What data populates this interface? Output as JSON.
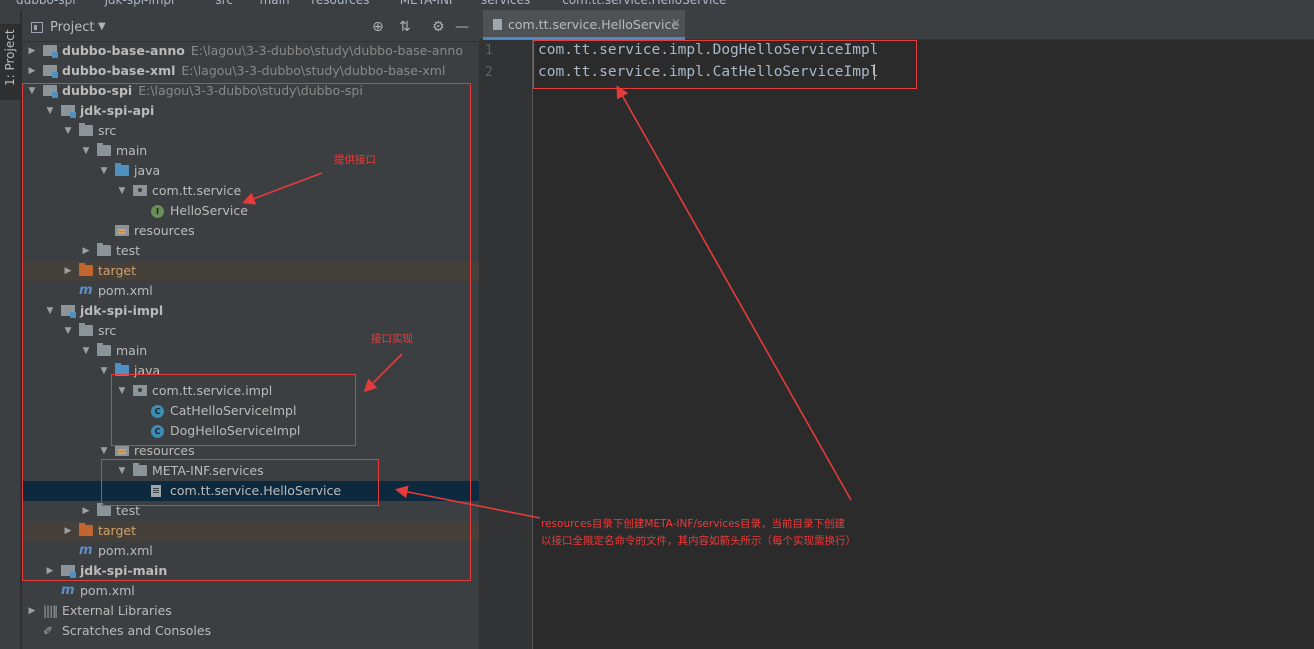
{
  "breadcrumbs": [
    "dubbo-spi",
    "jdk-spi-impl",
    "src",
    "main",
    "resources",
    "META-INF",
    "services",
    "com.tt.service.HelloService"
  ],
  "side_stripe": {
    "label": "1: Project"
  },
  "project_panel": {
    "title": "Project",
    "tools": [
      "locate-icon",
      "collapse-icon",
      "gear-icon",
      "hide-icon"
    ]
  },
  "tree": [
    {
      "label": "dubbo-base-anno",
      "path": "E:\\lagou\\3-3-dubbo\\study\\dubbo-base-anno",
      "icon": "module-icon",
      "arrow": "▶",
      "depth": 0,
      "bold": true
    },
    {
      "label": "dubbo-base-xml",
      "path": "E:\\lagou\\3-3-dubbo\\study\\dubbo-base-xml",
      "icon": "module-icon",
      "arrow": "▶",
      "depth": 0,
      "bold": true
    },
    {
      "label": "dubbo-spi",
      "path": "E:\\lagou\\3-3-dubbo\\study\\dubbo-spi",
      "icon": "module-icon",
      "arrow": "▼",
      "depth": 0,
      "bold": true
    },
    {
      "label": "jdk-spi-api",
      "icon": "module-icon",
      "arrow": "▼",
      "depth": 1,
      "bold": true
    },
    {
      "label": "src",
      "icon": "folder-icon",
      "arrow": "▼",
      "depth": 2
    },
    {
      "label": "main",
      "icon": "folder-icon",
      "arrow": "▼",
      "depth": 3
    },
    {
      "label": "java",
      "icon": "source-folder-icon",
      "arrow": "▼",
      "depth": 4
    },
    {
      "label": "com.tt.service",
      "icon": "package-icon",
      "arrow": "▼",
      "depth": 5
    },
    {
      "label": "HelloService",
      "icon": "interface-icon",
      "arrow": "",
      "depth": 6
    },
    {
      "label": "resources",
      "icon": "resources-folder-icon",
      "arrow": "",
      "depth": 4
    },
    {
      "label": "test",
      "icon": "folder-icon",
      "arrow": "▶",
      "depth": 3
    },
    {
      "label": "target",
      "icon": "excluded-folder-icon",
      "arrow": "▶",
      "depth": 2,
      "highlight": true
    },
    {
      "label": "pom.xml",
      "icon": "maven-icon",
      "arrow": "",
      "depth": 2
    },
    {
      "label": "jdk-spi-impl",
      "icon": "module-icon",
      "arrow": "▼",
      "depth": 1,
      "bold": true
    },
    {
      "label": "src",
      "icon": "folder-icon",
      "arrow": "▼",
      "depth": 2
    },
    {
      "label": "main",
      "icon": "folder-icon",
      "arrow": "▼",
      "depth": 3
    },
    {
      "label": "java",
      "icon": "source-folder-icon",
      "arrow": "▼",
      "depth": 4
    },
    {
      "label": "com.tt.service.impl",
      "icon": "package-icon",
      "arrow": "▼",
      "depth": 5
    },
    {
      "label": "CatHelloServiceImpl",
      "icon": "class-icon",
      "arrow": "",
      "depth": 6
    },
    {
      "label": "DogHelloServiceImpl",
      "icon": "class-icon",
      "arrow": "",
      "depth": 6
    },
    {
      "label": "resources",
      "icon": "resources-folder-icon",
      "arrow": "▼",
      "depth": 4
    },
    {
      "label": "META-INF.services",
      "icon": "folder-icon",
      "arrow": "▼",
      "depth": 5
    },
    {
      "label": "com.tt.service.HelloService",
      "icon": "text-file-icon",
      "arrow": "",
      "depth": 6,
      "selected": true
    },
    {
      "label": "test",
      "icon": "folder-icon",
      "arrow": "▶",
      "depth": 3
    },
    {
      "label": "target",
      "icon": "excluded-folder-icon",
      "arrow": "▶",
      "depth": 2,
      "highlight": true
    },
    {
      "label": "pom.xml",
      "icon": "maven-icon",
      "arrow": "",
      "depth": 2
    },
    {
      "label": "jdk-spi-main",
      "icon": "module-icon",
      "arrow": "▶",
      "depth": 1,
      "bold": true
    },
    {
      "label": "pom.xml",
      "icon": "maven-icon",
      "arrow": "",
      "depth": 1
    },
    {
      "label": "External Libraries",
      "icon": "libraries-icon",
      "arrow": "▶",
      "depth": 0
    },
    {
      "label": "Scratches and Consoles",
      "icon": "scratches-icon",
      "arrow": "",
      "depth": 0
    }
  ],
  "editor": {
    "tab_label": "com.tt.service.HelloService",
    "lines": [
      {
        "number": "1",
        "text": "com.tt.service.impl.DogHelloServiceImpl"
      },
      {
        "number": "2",
        "text": "com.tt.service.impl.CatHelloServiceImpl"
      }
    ]
  },
  "annotations": {
    "interface_note": "提供接口",
    "impl_note": "接口实现",
    "resources_note_line1": "resources目录下创建META-INF/services目录，当前目录下创建",
    "resources_note_line2": "以接口全限定名命令的文件，其内容如箭头所示（每个实现需换行）",
    "color": "#e53b3b"
  }
}
